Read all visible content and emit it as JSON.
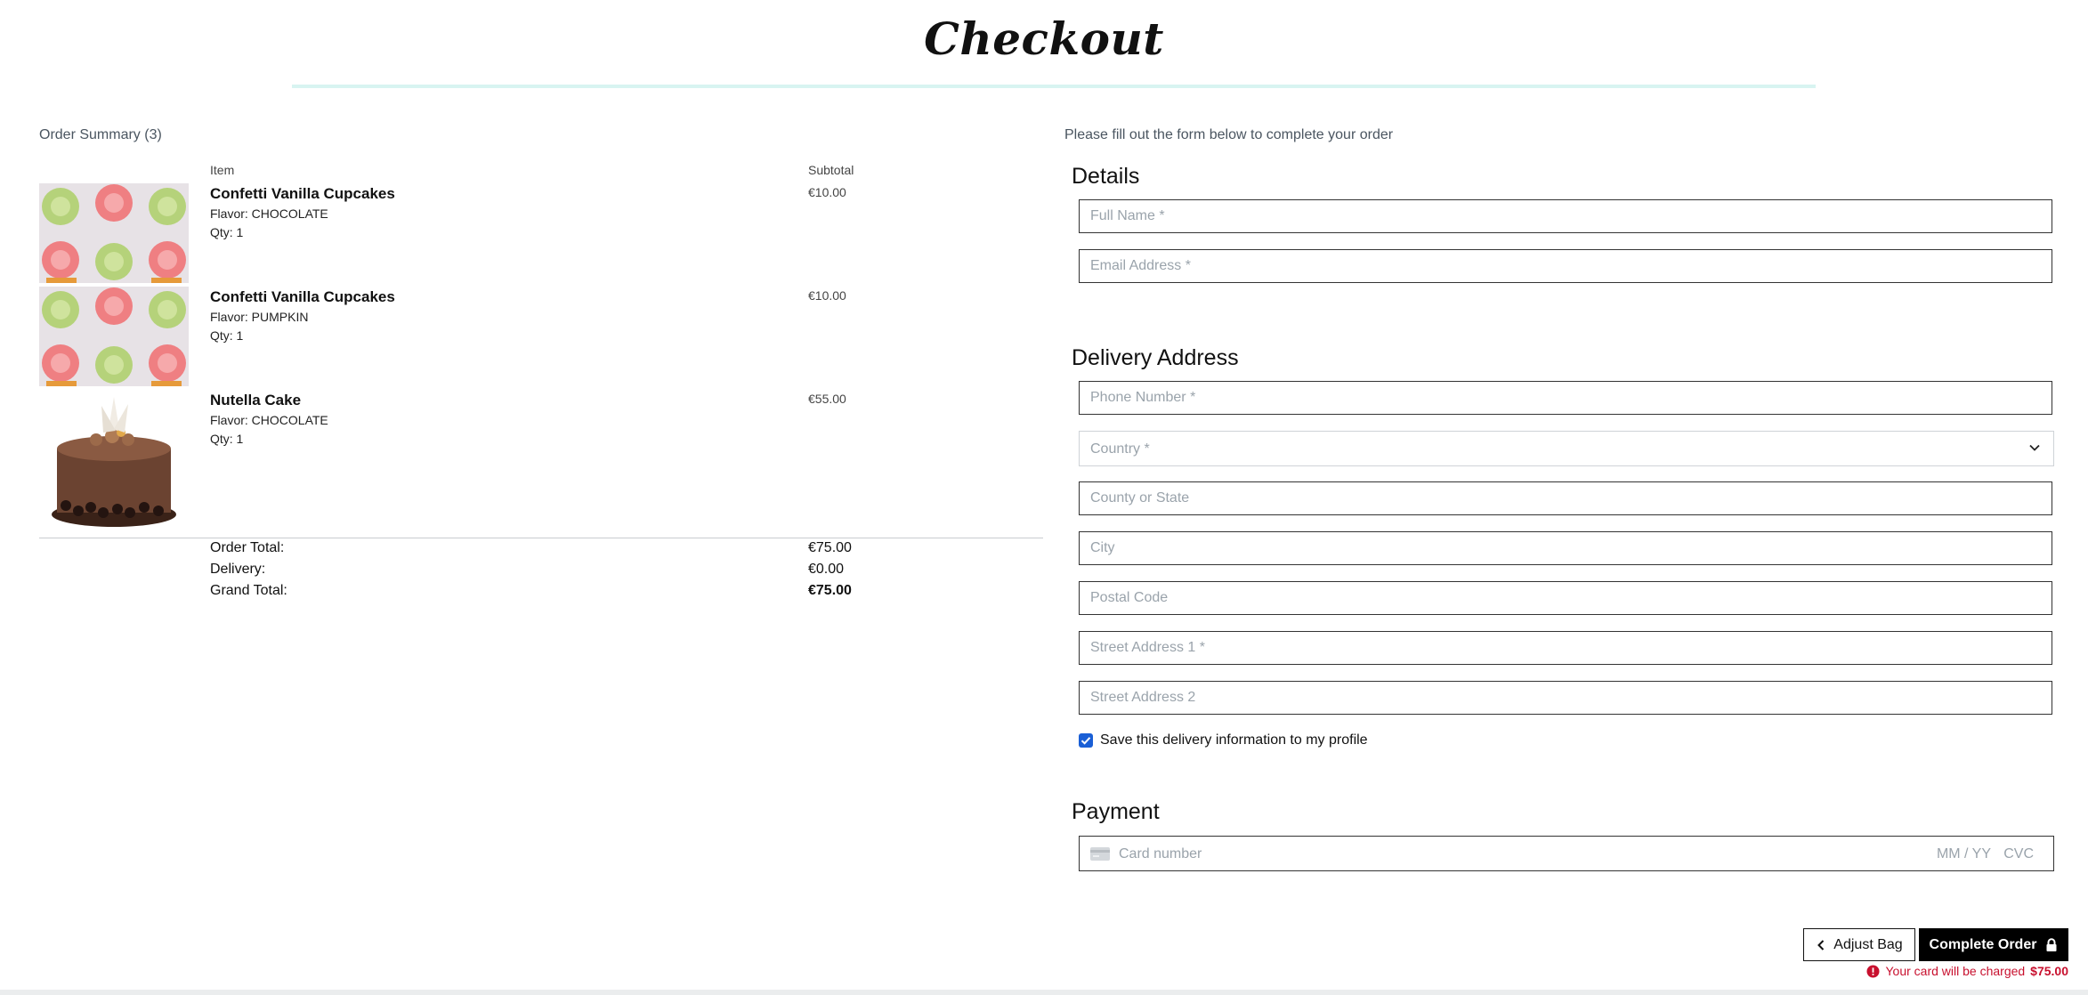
{
  "page": {
    "title": "Checkout"
  },
  "summary": {
    "heading": "Order Summary (3)",
    "col_item": "Item",
    "col_subtotal": "Subtotal",
    "items": [
      {
        "name": "Confetti Vanilla Cupcakes",
        "flavor": "Flavor: CHOCOLATE",
        "qty": "Qty: 1",
        "price": "€10.00"
      },
      {
        "name": "Confetti Vanilla Cupcakes",
        "flavor": "Flavor: PUMPKIN",
        "qty": "Qty: 1",
        "price": "€10.00"
      },
      {
        "name": "Nutella Cake",
        "flavor": "Flavor: CHOCOLATE",
        "qty": "Qty: 1",
        "price": "€55.00"
      }
    ],
    "totals": {
      "order_label": "Order Total:",
      "order_value": "€75.00",
      "delivery_label": "Delivery:",
      "delivery_value": "€0.00",
      "grand_label": "Grand Total:",
      "grand_value": "€75.00"
    }
  },
  "form": {
    "intro": "Please fill out the form below to complete your order",
    "details_heading": "Details",
    "full_name_ph": "Full Name *",
    "email_ph": "Email Address *",
    "delivery_heading": "Delivery Address",
    "phone_ph": "Phone Number *",
    "country_ph": "Country *",
    "county_ph": "County or State",
    "city_ph": "City",
    "postal_ph": "Postal Code",
    "street1_ph": "Street Address 1 *",
    "street2_ph": "Street Address 2",
    "save_info_label": "Save this delivery information to my profile",
    "save_info_checked": true,
    "payment_heading": "Payment",
    "card_number_ph": "Card number",
    "card_expiry_ph": "MM / YY",
    "card_cvc_ph": "CVC"
  },
  "actions": {
    "adjust_label": "Adjust Bag",
    "complete_label": "Complete Order",
    "charge_text": "Your card will be charged",
    "charge_amount": "$75.00"
  },
  "colors": {
    "accent_rule": "#d8f4f1",
    "checkbox": "#1a5fd6",
    "charge_note": "#c8102e"
  },
  "icons": [
    "chevron-left-icon",
    "lock-icon",
    "alert-circle-icon",
    "chevron-down-icon",
    "credit-card-icon",
    "checkmark-icon"
  ]
}
